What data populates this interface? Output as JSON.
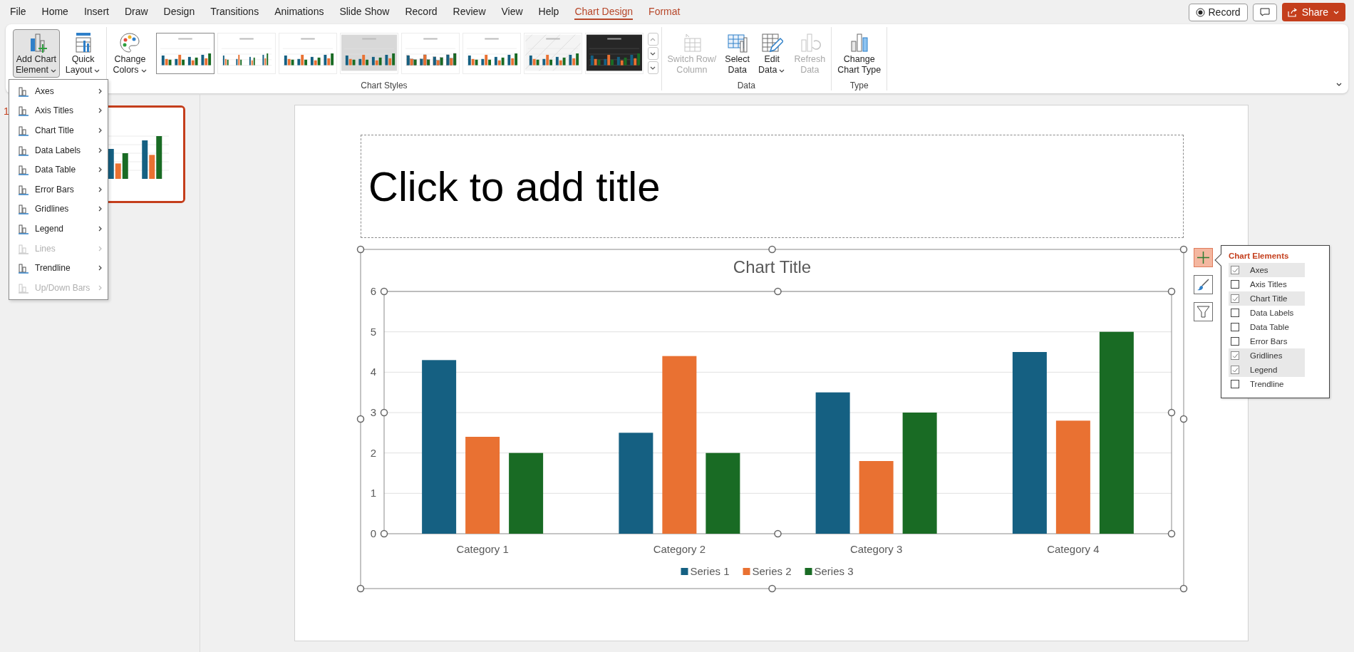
{
  "tabs": [
    {
      "label": "File",
      "selected": false,
      "kind": "standard"
    },
    {
      "label": "Home",
      "selected": false,
      "kind": "standard"
    },
    {
      "label": "Insert",
      "selected": false,
      "kind": "standard"
    },
    {
      "label": "Draw",
      "selected": false,
      "kind": "standard"
    },
    {
      "label": "Design",
      "selected": false,
      "kind": "standard"
    },
    {
      "label": "Transitions",
      "selected": false,
      "kind": "standard"
    },
    {
      "label": "Animations",
      "selected": false,
      "kind": "standard"
    },
    {
      "label": "Slide Show",
      "selected": false,
      "kind": "standard"
    },
    {
      "label": "Record",
      "selected": false,
      "kind": "standard"
    },
    {
      "label": "Review",
      "selected": false,
      "kind": "standard"
    },
    {
      "label": "View",
      "selected": false,
      "kind": "standard"
    },
    {
      "label": "Help",
      "selected": false,
      "kind": "standard"
    },
    {
      "label": "Chart Design",
      "selected": true,
      "kind": "contextual"
    },
    {
      "label": "Format",
      "selected": false,
      "kind": "contextual"
    }
  ],
  "top_actions": {
    "record": {
      "label": "Record"
    },
    "share": {
      "label": "Share"
    }
  },
  "ribbon": {
    "groups": [
      {
        "buttons": [
          {
            "kind": "add-element",
            "lines": [
              "Add Chart",
              "Element"
            ],
            "dropdown": true,
            "expanded": true,
            "disabled": false
          },
          {
            "kind": "quick-layout",
            "lines": [
              "Quick",
              "Layout"
            ],
            "dropdown": true,
            "expanded": false,
            "disabled": false
          }
        ]
      },
      {
        "label": "Chart Styles",
        "buttons": [
          {
            "kind": "colors",
            "lines": [
              "Change",
              "Colors"
            ],
            "dropdown": true,
            "expanded": false,
            "disabled": false
          }
        ],
        "gallery": [
          {
            "kind": "plain",
            "selected": true
          },
          {
            "kind": "thin",
            "selected": false
          },
          {
            "kind": "stacked",
            "selected": false
          },
          {
            "kind": "gray",
            "selected": false
          },
          {
            "kind": "outlined",
            "selected": false
          },
          {
            "kind": "plain",
            "selected": false
          },
          {
            "kind": "hatched",
            "selected": false
          },
          {
            "kind": "dark",
            "selected": false
          }
        ]
      },
      {
        "label": "Data",
        "buttons": [
          {
            "kind": "switch",
            "lines": [
              "Switch Row/",
              "Column"
            ],
            "dropdown": false,
            "expanded": false,
            "disabled": true
          },
          {
            "kind": "select-data",
            "lines": [
              "Select",
              "Data"
            ],
            "dropdown": false,
            "expanded": false,
            "disabled": false
          },
          {
            "kind": "edit-data",
            "lines": [
              "Edit",
              "Data"
            ],
            "dropdown": true,
            "expanded": false,
            "disabled": false
          },
          {
            "kind": "refresh",
            "lines": [
              "Refresh",
              "Data"
            ],
            "dropdown": false,
            "expanded": false,
            "disabled": true
          }
        ]
      },
      {
        "label": "Type",
        "buttons": [
          {
            "kind": "change-type",
            "lines": [
              "Change",
              "Chart Type"
            ],
            "dropdown": false,
            "expanded": false,
            "disabled": false
          }
        ]
      }
    ]
  },
  "add_chart_element_menu": [
    {
      "label": "Axes",
      "disabled": false
    },
    {
      "label": "Axis Titles",
      "disabled": false
    },
    {
      "label": "Chart Title",
      "disabled": false
    },
    {
      "label": "Data Labels",
      "disabled": false
    },
    {
      "label": "Data Table",
      "disabled": false
    },
    {
      "label": "Error Bars",
      "disabled": false
    },
    {
      "label": "Gridlines",
      "disabled": false
    },
    {
      "label": "Legend",
      "disabled": false
    },
    {
      "label": "Lines",
      "disabled": true
    },
    {
      "label": "Trendline",
      "disabled": false
    },
    {
      "label": "Up/Down Bars",
      "disabled": true
    }
  ],
  "slides": [
    {
      "number": "1",
      "selected": true
    }
  ],
  "slide": {
    "title_placeholder": "Click to add title",
    "chart": {
      "chart_data": {
        "type": "bar",
        "title": "Chart Title",
        "categories": [
          "Category 1",
          "Category 2",
          "Category 3",
          "Category 4"
        ],
        "series": [
          {
            "name": "Series 1",
            "color": "#156082",
            "values": [
              4.3,
              2.5,
              3.5,
              4.5
            ]
          },
          {
            "name": "Series 2",
            "color": "#e97132",
            "values": [
              2.4,
              4.4,
              1.8,
              2.8
            ]
          },
          {
            "name": "Series 3",
            "color": "#196b24",
            "values": [
              2,
              2,
              3,
              5
            ]
          }
        ],
        "ylim": [
          0,
          6
        ],
        "yticks": [
          0,
          1,
          2,
          3,
          4,
          5,
          6
        ],
        "grid": true,
        "legend": true
      }
    }
  },
  "chart_elements": {
    "title": "Chart Elements",
    "items": [
      {
        "label": "Axes",
        "checked": true
      },
      {
        "label": "Axis Titles",
        "checked": false
      },
      {
        "label": "Chart Title",
        "checked": true
      },
      {
        "label": "Data Labels",
        "checked": false
      },
      {
        "label": "Data Table",
        "checked": false
      },
      {
        "label": "Error Bars",
        "checked": false
      },
      {
        "label": "Gridlines",
        "checked": true
      },
      {
        "label": "Legend",
        "checked": true
      },
      {
        "label": "Trendline",
        "checked": false
      }
    ]
  }
}
